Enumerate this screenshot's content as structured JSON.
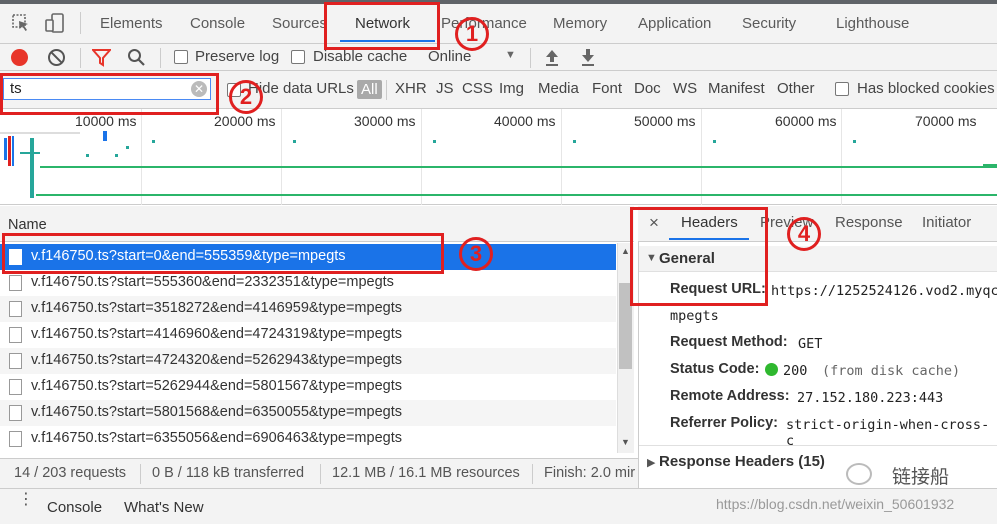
{
  "tabs": [
    {
      "label": "Elements"
    },
    {
      "label": "Console"
    },
    {
      "label": "Sources"
    },
    {
      "label": "Network"
    },
    {
      "label": "Performance"
    },
    {
      "label": "Memory"
    },
    {
      "label": "Application"
    },
    {
      "label": "Security"
    },
    {
      "label": "Lighthouse"
    }
  ],
  "toolbar": {
    "preserve_log": "Preserve log",
    "disable_cache": "Disable cache",
    "throttle": "Online"
  },
  "filter": {
    "value": "ts",
    "hide_data_urls": "Hide data URLs",
    "types": [
      "All",
      "XHR",
      "JS",
      "CSS",
      "Img",
      "Media",
      "Font",
      "Doc",
      "WS",
      "Manifest",
      "Other"
    ],
    "blocked_cookies": "Has blocked cookies"
  },
  "timeline": {
    "ticks": [
      "10000 ms",
      "20000 ms",
      "30000 ms",
      "40000 ms",
      "50000 ms",
      "60000 ms",
      "70000 ms"
    ]
  },
  "list": {
    "header": "Name",
    "rows": [
      "v.f146750.ts?start=0&end=555359&type=mpegts",
      "v.f146750.ts?start=555360&end=2332351&type=mpegts",
      "v.f146750.ts?start=3518272&end=4146959&type=mpegts",
      "v.f146750.ts?start=4146960&end=4724319&type=mpegts",
      "v.f146750.ts?start=4724320&end=5262943&type=mpegts",
      "v.f146750.ts?start=5262944&end=5801567&type=mpegts",
      "v.f146750.ts?start=5801568&end=6350055&type=mpegts",
      "v.f146750.ts?start=6355056&end=6906463&type=mpegts"
    ]
  },
  "status": {
    "requests": "14 / 203 requests",
    "transferred": "0 B / 118 kB transferred",
    "resources": "12.1 MB / 16.1 MB resources",
    "finish": "Finish: 2.0 mir"
  },
  "details": {
    "close": "×",
    "tabs": [
      "Headers",
      "Preview",
      "Response",
      "Initiator"
    ],
    "general_title": "General",
    "request_url_label": "Request URL:",
    "request_url_value": "https://1252524126.vod2.myqc",
    "request_url_cont": "mpegts",
    "request_method_label": "Request Method:",
    "request_method_value": "GET",
    "status_code_label": "Status Code:",
    "status_code_value": "200",
    "status_code_note": "(from disk cache)",
    "remote_address_label": "Remote Address:",
    "remote_address_value": "27.152.180.223:443",
    "referrer_policy_label": "Referrer Policy:",
    "referrer_policy_value": "strict-origin-when-cross-c",
    "response_headers": "Response Headers (15)"
  },
  "drawer": {
    "console": "Console",
    "whats_new": "What's New"
  },
  "annotations": [
    "1",
    "2",
    "3",
    "4"
  ],
  "watermark": {
    "brand": "链接船",
    "url": "https://blog.csdn.net/weixin_50601932"
  },
  "colors": {
    "accent": "#1a73e8",
    "annotation": "#e02020",
    "status_ok": "#2fb82f"
  }
}
